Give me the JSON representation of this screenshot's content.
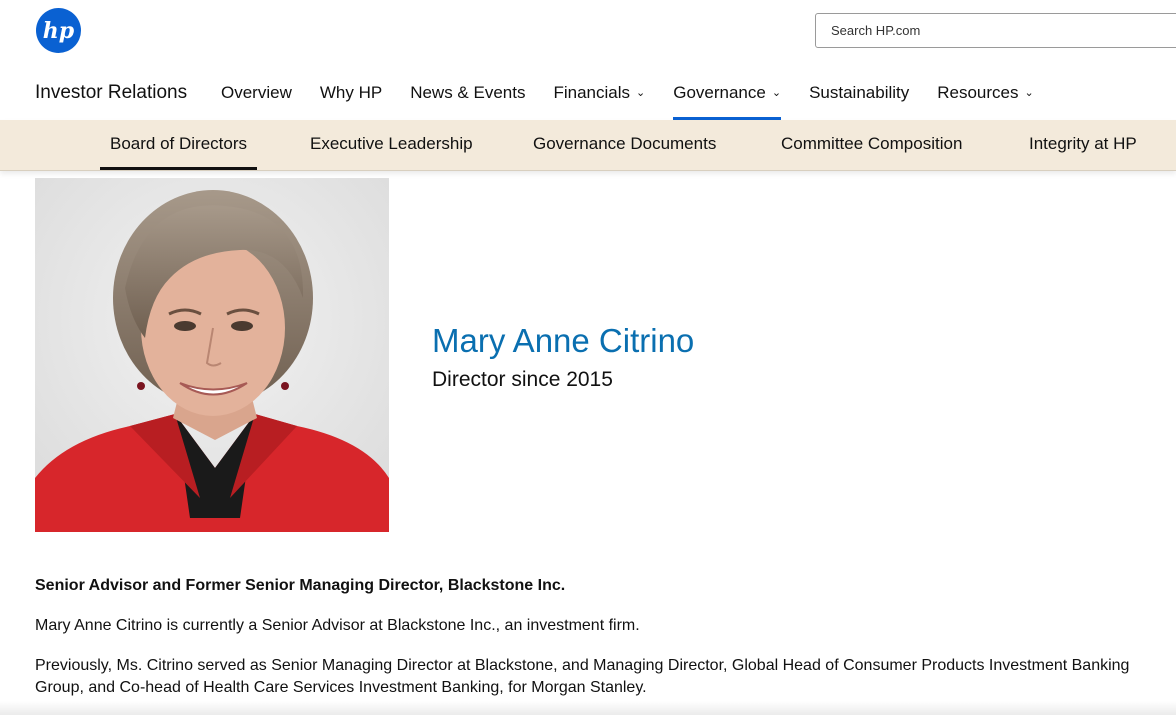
{
  "header": {
    "logo_text": "hp",
    "search_placeholder": "Search HP.com"
  },
  "main_nav": {
    "title": "Investor Relations",
    "items": [
      {
        "label": "Overview",
        "has_dropdown": false
      },
      {
        "label": "Why HP",
        "has_dropdown": false
      },
      {
        "label": "News & Events",
        "has_dropdown": false
      },
      {
        "label": "Financials",
        "has_dropdown": true
      },
      {
        "label": "Governance",
        "has_dropdown": true,
        "active": true
      },
      {
        "label": "Sustainability",
        "has_dropdown": false
      },
      {
        "label": "Resources",
        "has_dropdown": true
      }
    ],
    "chevron": "⌄"
  },
  "sub_nav": {
    "items": [
      {
        "label": "Board of Directors",
        "active": true
      },
      {
        "label": "Executive Leadership"
      },
      {
        "label": "Governance Documents"
      },
      {
        "label": "Committee Composition"
      },
      {
        "label": "Integrity at HP"
      }
    ]
  },
  "profile": {
    "name": "Mary Anne Citrino",
    "role": "Director since 2015",
    "heading": "Senior Advisor and Former Senior Managing Director, Blackstone Inc.",
    "paragraph_1": "Mary Anne Citrino is currently a Senior Advisor at Blackstone Inc., an investment firm.",
    "paragraph_2": "Previously, Ms. Citrino served as Senior Managing Director at Blackstone, and Managing Director, Global Head of Consumer Products Investment Banking Group, and Co-head of Health Care Services Investment Banking, for Morgan Stanley."
  },
  "colors": {
    "brand_blue": "#0a61d2",
    "name_blue": "#0a6fb0",
    "subnav_bg": "#f3eadb"
  }
}
